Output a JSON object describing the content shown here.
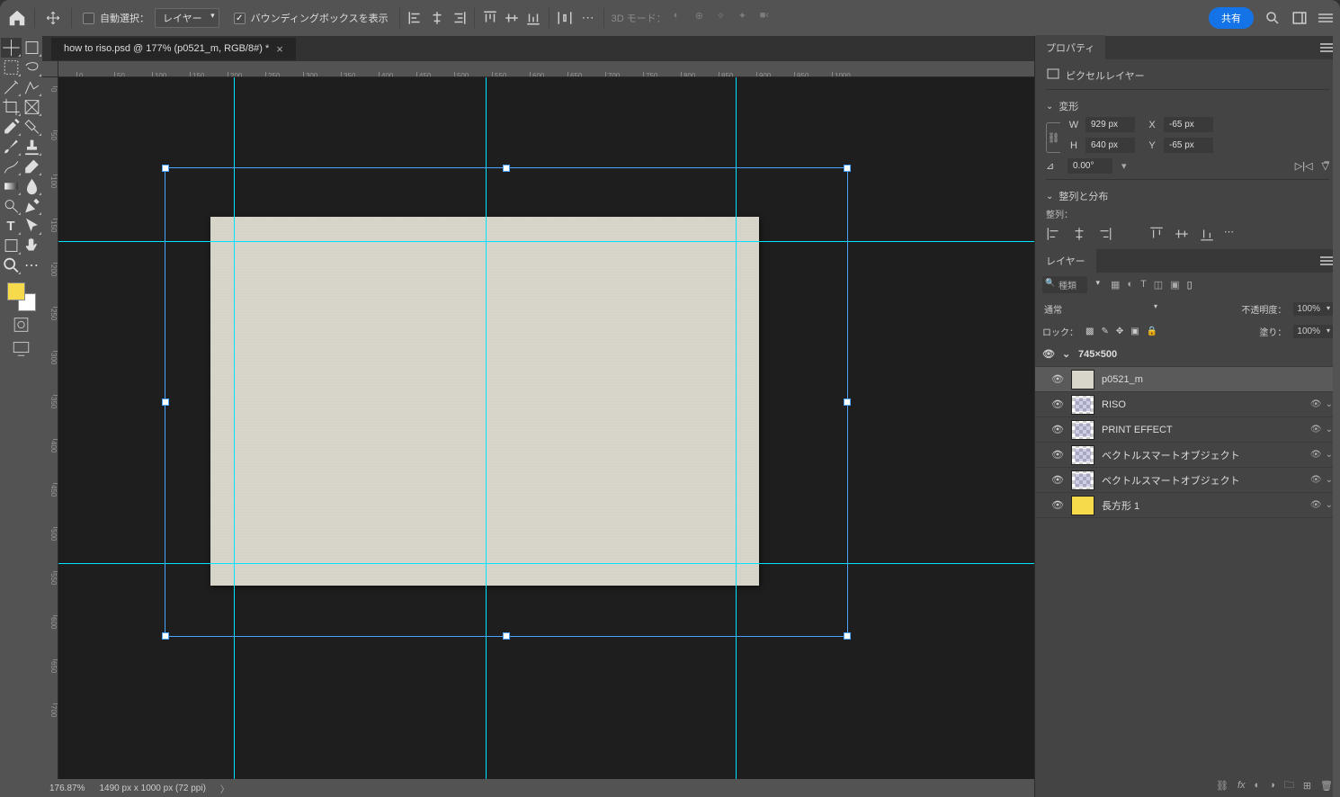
{
  "topbar": {
    "auto_select_label": "自動選択：",
    "layer_mode": "レイヤー",
    "show_bbox_label": "バウンディングボックスを表示",
    "mode3d_label": "3D モード：",
    "share_label": "共有"
  },
  "document": {
    "tab_title": "how to riso.psd @ 177% (p0521_m, RGB/8#) *"
  },
  "ruler_h": [
    0,
    50,
    100,
    150,
    200,
    250,
    300,
    350,
    400,
    450,
    500,
    550,
    600,
    650,
    700,
    750,
    800,
    850,
    900,
    950,
    1000
  ],
  "ruler_v": [
    0,
    50,
    100,
    150,
    200,
    250,
    300,
    350,
    400,
    450,
    500,
    550,
    600,
    650,
    700
  ],
  "panels": {
    "properties": {
      "title": "プロパティ",
      "layer_type": "ピクセルレイヤー",
      "transform": "変形",
      "W": "W",
      "W_val": "929 px",
      "H": "H",
      "H_val": "640 px",
      "X": "X",
      "X_val": "-65 px",
      "Y": "Y",
      "Y_val": "-65 px",
      "angle_val": "0.00°",
      "align_dist": "整列と分布",
      "align_label": "整列："
    },
    "layers": {
      "title": "レイヤー",
      "filter_kind": "種類",
      "blend_mode": "通常",
      "opacity_label": "不透明度：",
      "opacity_val": "100%",
      "lock_label": "ロック：",
      "fill_label": "塗り：",
      "fill_val": "100%",
      "items": [
        {
          "name": "745×500",
          "type": "group"
        },
        {
          "name": "p0521_m",
          "type": "pixel",
          "selected": true
        },
        {
          "name": "RISO",
          "type": "so",
          "fxcaret": true
        },
        {
          "name": "PRINT  EFFECT",
          "type": "so",
          "fxcaret": true
        },
        {
          "name": "ベクトルスマートオブジェクト",
          "type": "so",
          "fxcaret": true
        },
        {
          "name": "ベクトルスマートオブジェクト",
          "type": "so2",
          "fxcaret": true
        },
        {
          "name": "長方形 1",
          "type": "yellow",
          "fxcaret": true
        }
      ]
    }
  },
  "status": {
    "zoom": "176.87%",
    "docsize": "1490 px x 1000 px (72 ppi)"
  }
}
